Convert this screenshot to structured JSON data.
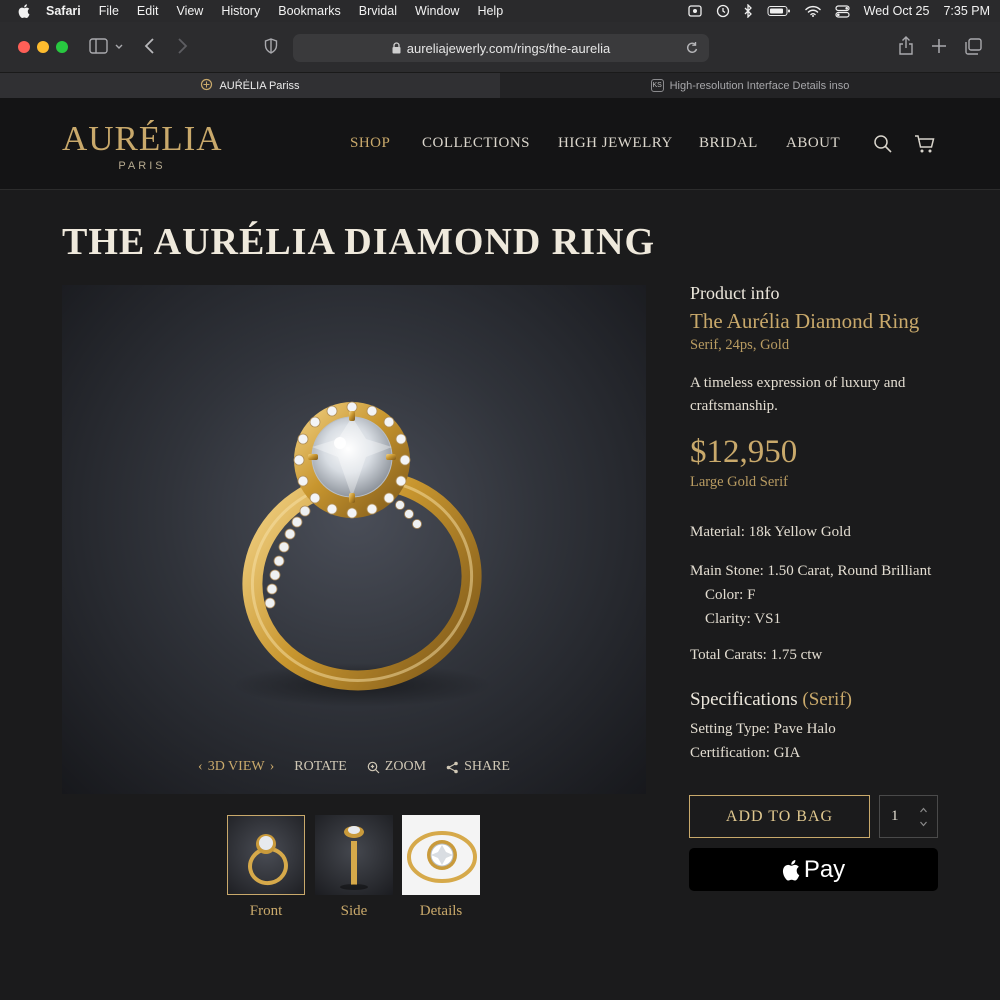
{
  "menubar": {
    "app": "Safari",
    "items": [
      "File",
      "Edit",
      "View",
      "History",
      "Bookmarks",
      "Brvidal",
      "Window",
      "Help"
    ],
    "date": "Wed Oct 25",
    "time": "7:35 PM"
  },
  "browser": {
    "url": "aureliajewerly.com/rings/the-aurelia",
    "tabs": [
      {
        "label": "AUŔĖLIA Pariss",
        "active": true
      },
      {
        "label": "High-resolution Interface Details inso",
        "active": false,
        "favicon_text": "KS"
      }
    ]
  },
  "site": {
    "logo": {
      "word": "AURÉLIA",
      "sub": "PARIS"
    },
    "nav": [
      "SHOP",
      "COLLECTIONS",
      "HIGH JEWELRY",
      "BRIDAL",
      "ABOUT"
    ],
    "nav_active": "SHOP"
  },
  "product": {
    "title": "THE AURÉLIA DIAMOND RING",
    "viewer_controls": {
      "view3d": "3D VIEW",
      "rotate": "ROTATE",
      "zoom": "ZOOM",
      "share": "SHARE"
    },
    "thumbnails": [
      "Front",
      "Side",
      "Details"
    ],
    "info": {
      "heading": "Product info",
      "name": "The Aurélia Diamond Ring",
      "name_meta": "Serif, 24ps, Gold",
      "description": "A timeless expression of luxury and craftsmanship.",
      "price": "$12,950",
      "price_meta": "Large Gold Serif",
      "material": "Material: 18k Yellow Gold",
      "main_stone": "Main Stone: 1.50 Carat, Round Brilliant",
      "color": "Color: F",
      "clarity": "Clarity: VS1",
      "total_carats": "Total Carats: 1.75 ctw",
      "specs_heading": "Specifications",
      "specs_heading_note": "(Serif)",
      "setting_type": "Setting Type: Pave Halo",
      "certification": "Certification: GIA"
    },
    "actions": {
      "add_to_bag": "ADD TO BAG",
      "quantity": "1",
      "apple_pay": "Pay"
    }
  },
  "colors": {
    "gold": "#c9a96b",
    "background": "#1b1b1c",
    "header": "#141415"
  }
}
